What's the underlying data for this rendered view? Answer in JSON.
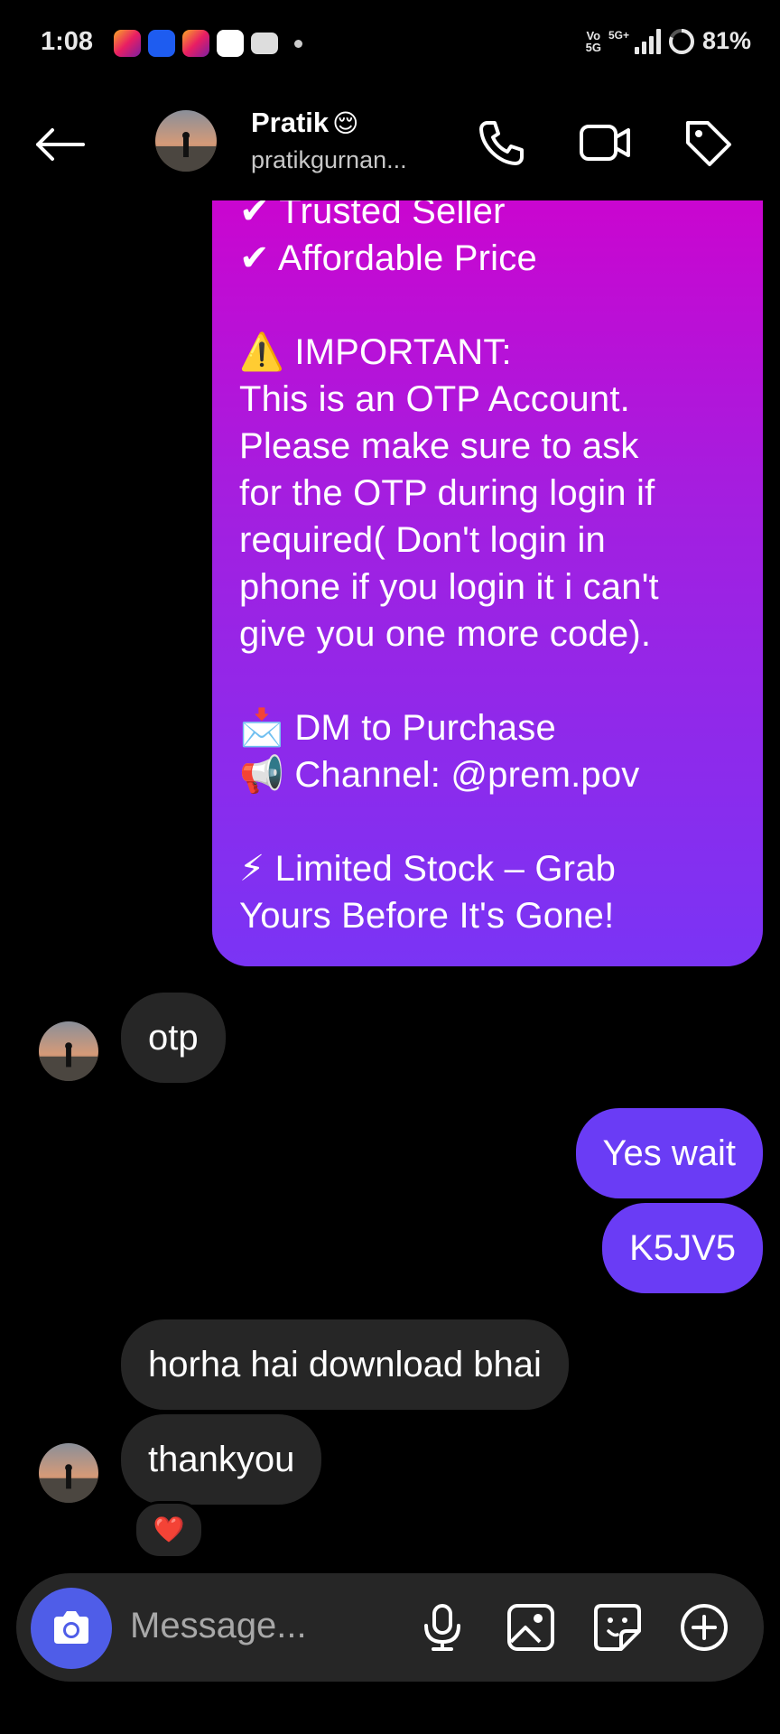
{
  "status_bar": {
    "time": "1:08",
    "network_top": "Vo",
    "network_bottom": "5G",
    "signal_label": "5G+",
    "battery": "81%"
  },
  "header": {
    "name": "Pratik",
    "name_emoji": "😌",
    "username": "pratikgurnan..."
  },
  "sent_promo_lines": [
    "✔ Trusted Seller",
    "✔ Affordable Price",
    "",
    "⚠️ IMPORTANT:",
    "This is an OTP Account.",
    "Please make sure to ask",
    "for the OTP during login if",
    "required( Don't login in",
    "phone if you login it i can't",
    "give you one more code).",
    "",
    "📩 DM to Purchase",
    "📢 Channel: @prem.pov",
    "",
    "⚡ Limited Stock – Grab",
    "Yours Before It's Gone!"
  ],
  "messages": {
    "recv_1": "otp",
    "sent_1": "Yes wait",
    "sent_2": "K5JV5",
    "recv_2": "horha hai download bhai",
    "recv_3": "thankyou",
    "reaction": "❤️"
  },
  "composer": {
    "placeholder": "Message..."
  },
  "colors": {
    "sent_bubble": "#6a3cf5",
    "recv_bubble": "#262626",
    "camera_button": "#4f5de8",
    "promo_gradient_top": "#d200cc",
    "promo_gradient_bottom": "#7a34f5"
  }
}
